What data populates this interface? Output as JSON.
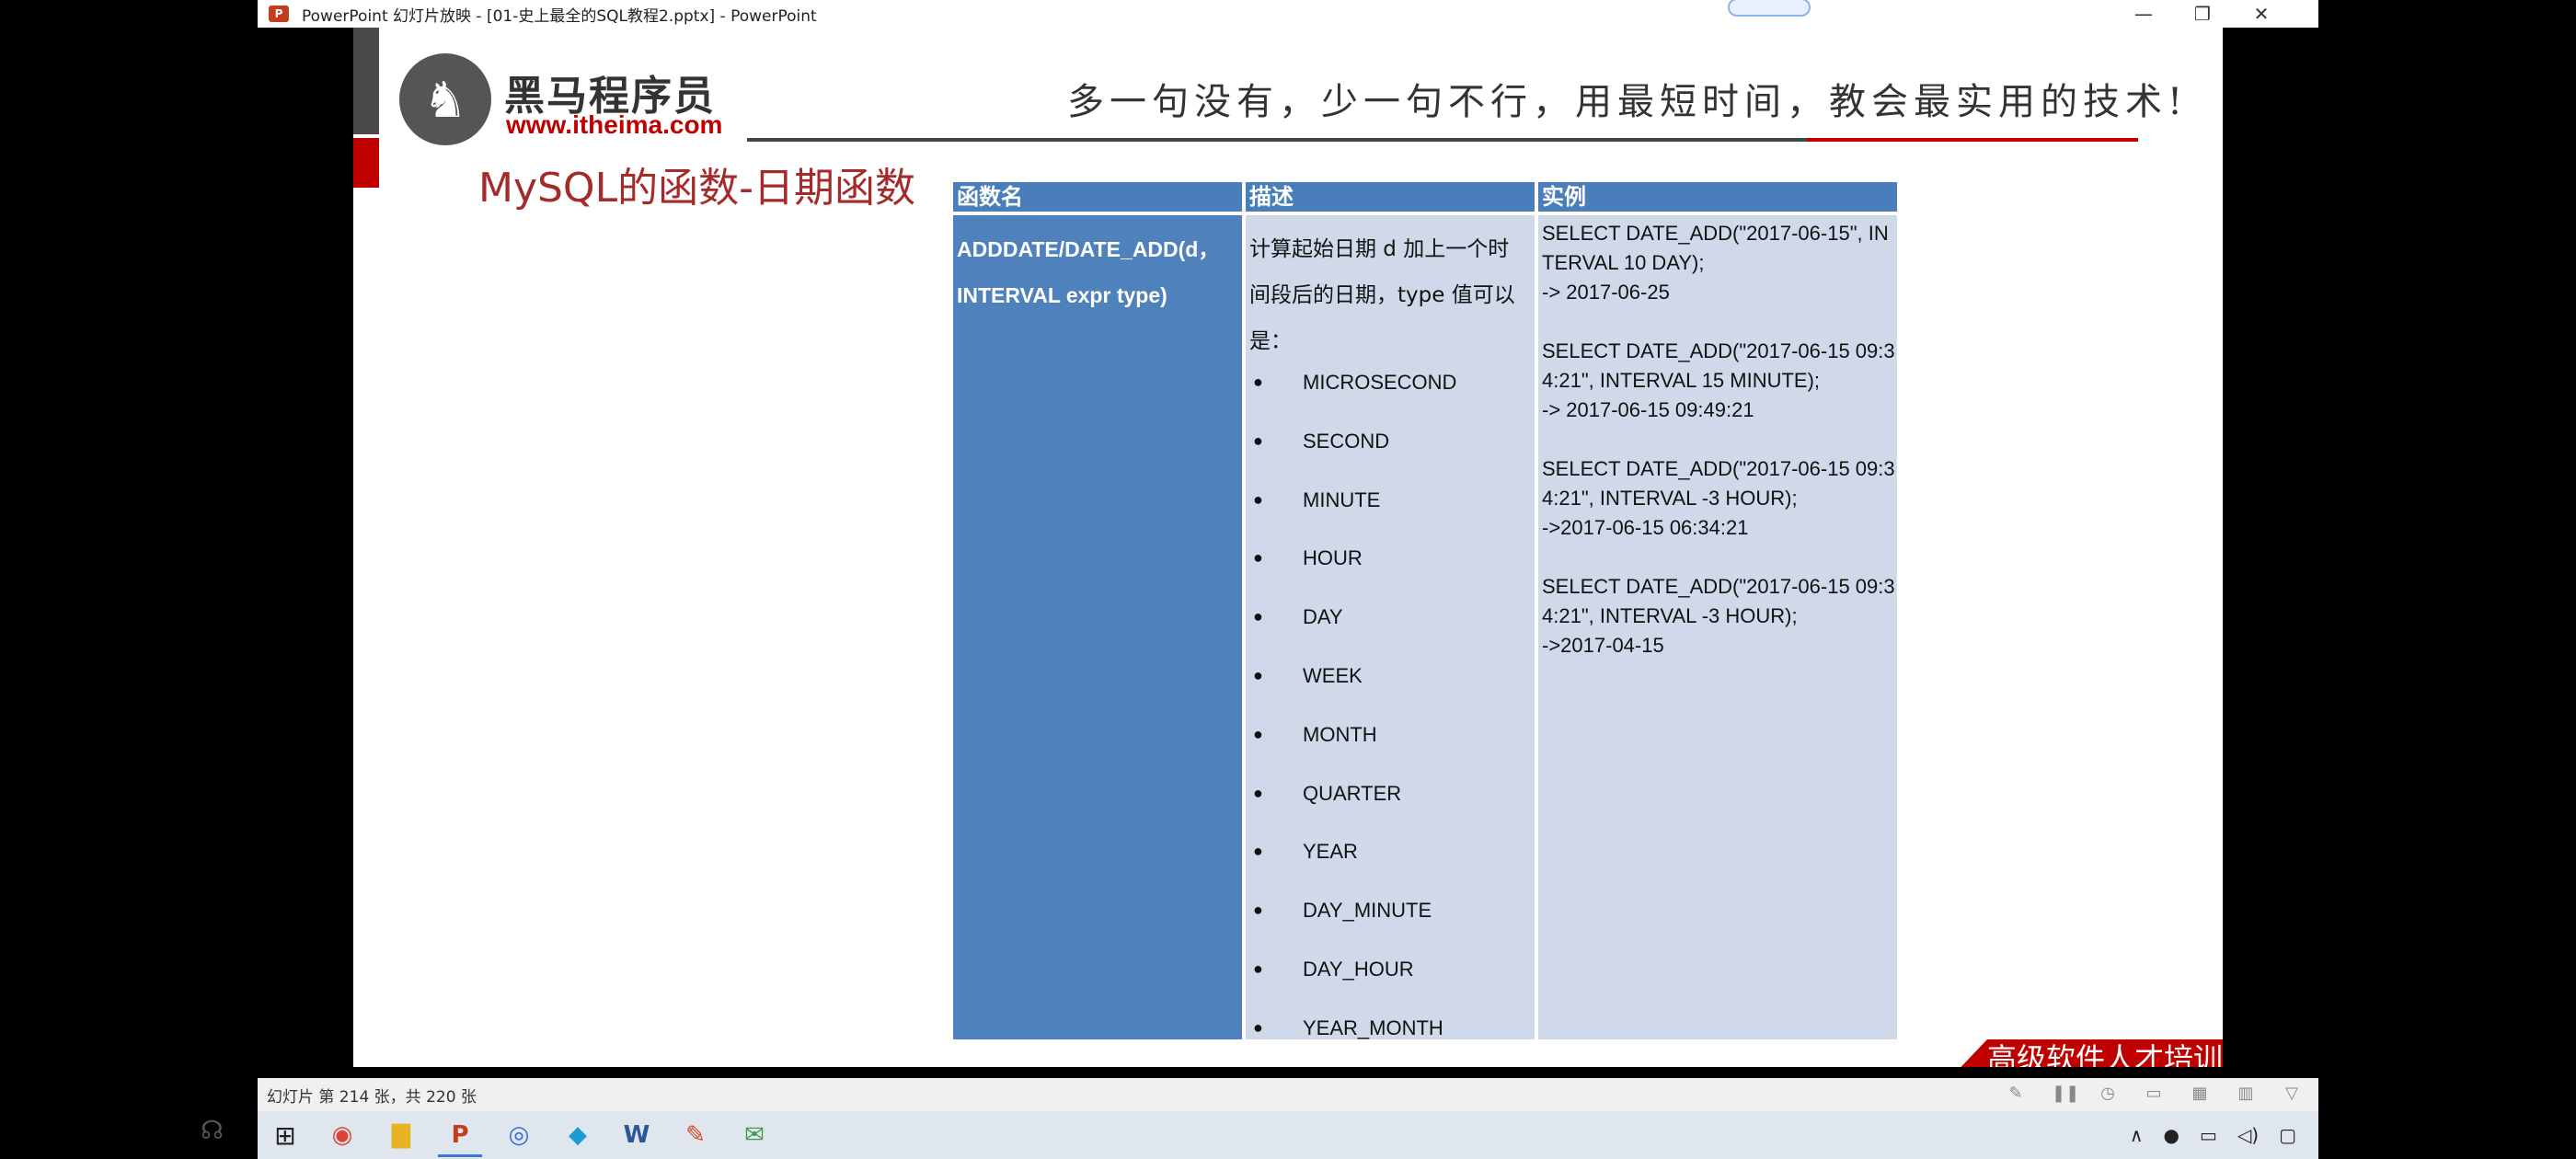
{
  "window": {
    "title": "PowerPoint 幻灯片放映 - [01-史上最全的SQL教程2.pptx] - PowerPoint",
    "app_icon": "P",
    "controls": [
      "—",
      "❐",
      "✕"
    ]
  },
  "slide": {
    "logo_cn": "黑马程序员",
    "logo_url": "www.itheima.com",
    "slogan": "多一句没有，少一句不行，用最短时间，教会最实用的技术!",
    "title": "MySQL的函数-日期函数",
    "table": {
      "headers": [
        "函数名",
        "描述",
        "实例"
      ],
      "function_name_lines": [
        "ADDDATE/DATE_ADD(d，",
        "INTERVAL expr type)"
      ],
      "description_lines": [
        "计算起始日期 d 加上一个时",
        "间段后的日期，type 值可以",
        "是："
      ],
      "types": [
        "MICROSECOND",
        "SECOND",
        "MINUTE",
        "HOUR",
        "DAY",
        "WEEK",
        "MONTH",
        "QUARTER",
        "YEAR",
        "DAY_MINUTE",
        "DAY_HOUR",
        "YEAR_MONTH"
      ],
      "examples": [
        [
          "SELECT DATE_ADD(\"2017-06-15\", IN",
          "TERVAL 10 DAY);",
          "-> 2017-06-25"
        ],
        [
          "SELECT DATE_ADD(\"2017-06-15 09:3",
          "4:21\", INTERVAL 15 MINUTE);",
          "-> 2017-06-15 09:49:21"
        ],
        [
          "SELECT DATE_ADD(\"2017-06-15 09:3",
          "4:21\", INTERVAL -3 HOUR);",
          "->2017-06-15 06:34:21"
        ],
        [
          "SELECT DATE_ADD(\"2017-06-15 09:3",
          "4:21\", INTERVAL -3 HOUR);",
          "->2017-04-15"
        ]
      ]
    },
    "footer_banner": "高级软件人才培训专家"
  },
  "status_bar": {
    "slide_info": "幻灯片 第 214 张，共 220 张"
  },
  "taskbar": {
    "start_icon": "windows-icon",
    "apps": [
      {
        "name": "chrome-icon",
        "glyph": "◉"
      },
      {
        "name": "file-explorer-icon",
        "glyph": "▇"
      },
      {
        "name": "powerpoint-icon",
        "glyph": "P"
      },
      {
        "name": "app-icon-blue",
        "glyph": "◎"
      },
      {
        "name": "app-icon-cyan",
        "glyph": "◆"
      },
      {
        "name": "word-icon",
        "glyph": "W"
      },
      {
        "name": "app-icon-red",
        "glyph": "✎"
      },
      {
        "name": "app-icon-green",
        "glyph": "✉"
      }
    ]
  },
  "colors": {
    "header_blue": "#4a7ebb",
    "col1_blue": "#4f81bd",
    "cell_light": "#d0d9ea",
    "title_red": "#a52a2a",
    "brand_red": "#c00000"
  }
}
